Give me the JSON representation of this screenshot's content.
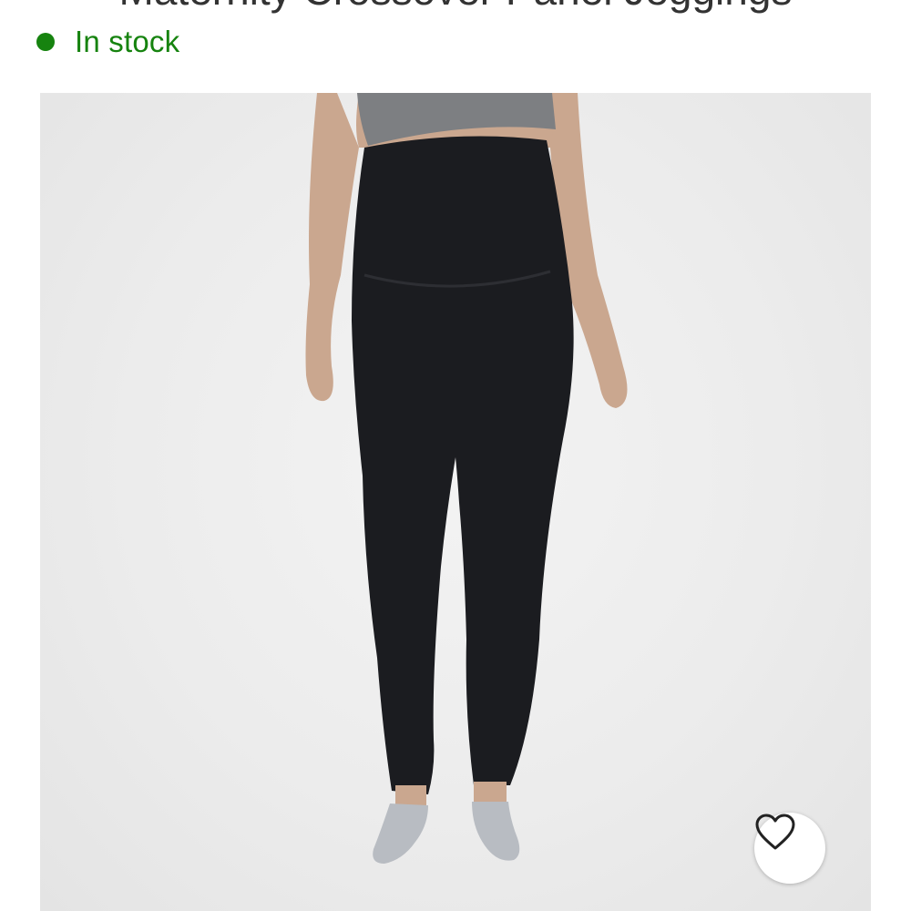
{
  "header": {
    "clipped_title": "Maternity Crossover Panel Jeggings"
  },
  "availability": {
    "status_label": "In stock",
    "status_color": "#16830f"
  },
  "product": {
    "image_icon": "product-photo",
    "colors": {
      "background": "#ececec",
      "garment": "#1b1c20",
      "top": "#7d7f82",
      "shoes": "#b8bcc2"
    }
  },
  "favorite": {
    "icon": "heart-icon"
  }
}
